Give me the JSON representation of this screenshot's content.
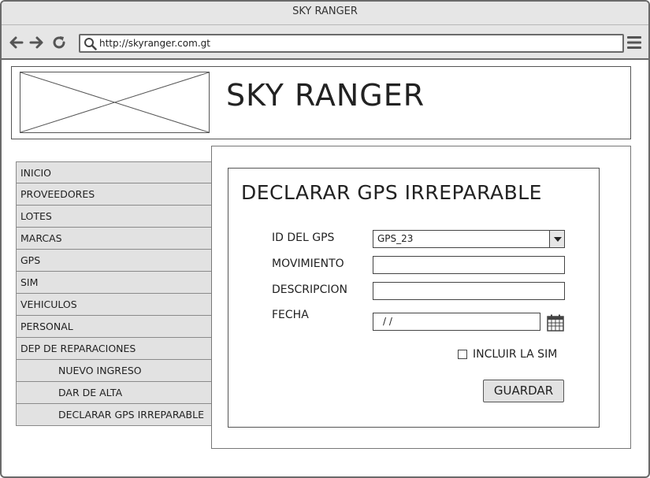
{
  "window": {
    "title": "SKY RANGER"
  },
  "browser": {
    "url": "http://skyranger.com.gt",
    "icons": [
      "back-icon",
      "forward-icon",
      "reload-icon",
      "search-icon",
      "hamburger-menu-icon"
    ]
  },
  "header": {
    "site_title": "SKY RANGER"
  },
  "sidebar": {
    "items": [
      {
        "label": "INICIO"
      },
      {
        "label": "PROVEEDORES"
      },
      {
        "label": "LOTES"
      },
      {
        "label": "MARCAS"
      },
      {
        "label": "GPS"
      },
      {
        "label": "SIM"
      },
      {
        "label": "VEHICULOS"
      },
      {
        "label": "PERSONAL"
      },
      {
        "label": "DEP DE REPARACIONES"
      },
      {
        "label": "NUEVO INGRESO"
      },
      {
        "label": "DAR DE ALTA"
      },
      {
        "label": "DECLARAR GPS IRREPARABLE"
      }
    ]
  },
  "form": {
    "title": "DECLARAR GPS IRREPARABLE",
    "gps_id": {
      "label": "ID DEL GPS",
      "value": "GPS_23"
    },
    "movimiento": {
      "label": "MOVIMIENTO",
      "value": ""
    },
    "descripcion": {
      "label": "DESCRIPCION",
      "value": ""
    },
    "fecha": {
      "label": "FECHA",
      "value": "/ /"
    },
    "include_sim": {
      "label": "INCLUIR LA SIM",
      "checked": false
    },
    "save_label": "GUARDAR"
  }
}
